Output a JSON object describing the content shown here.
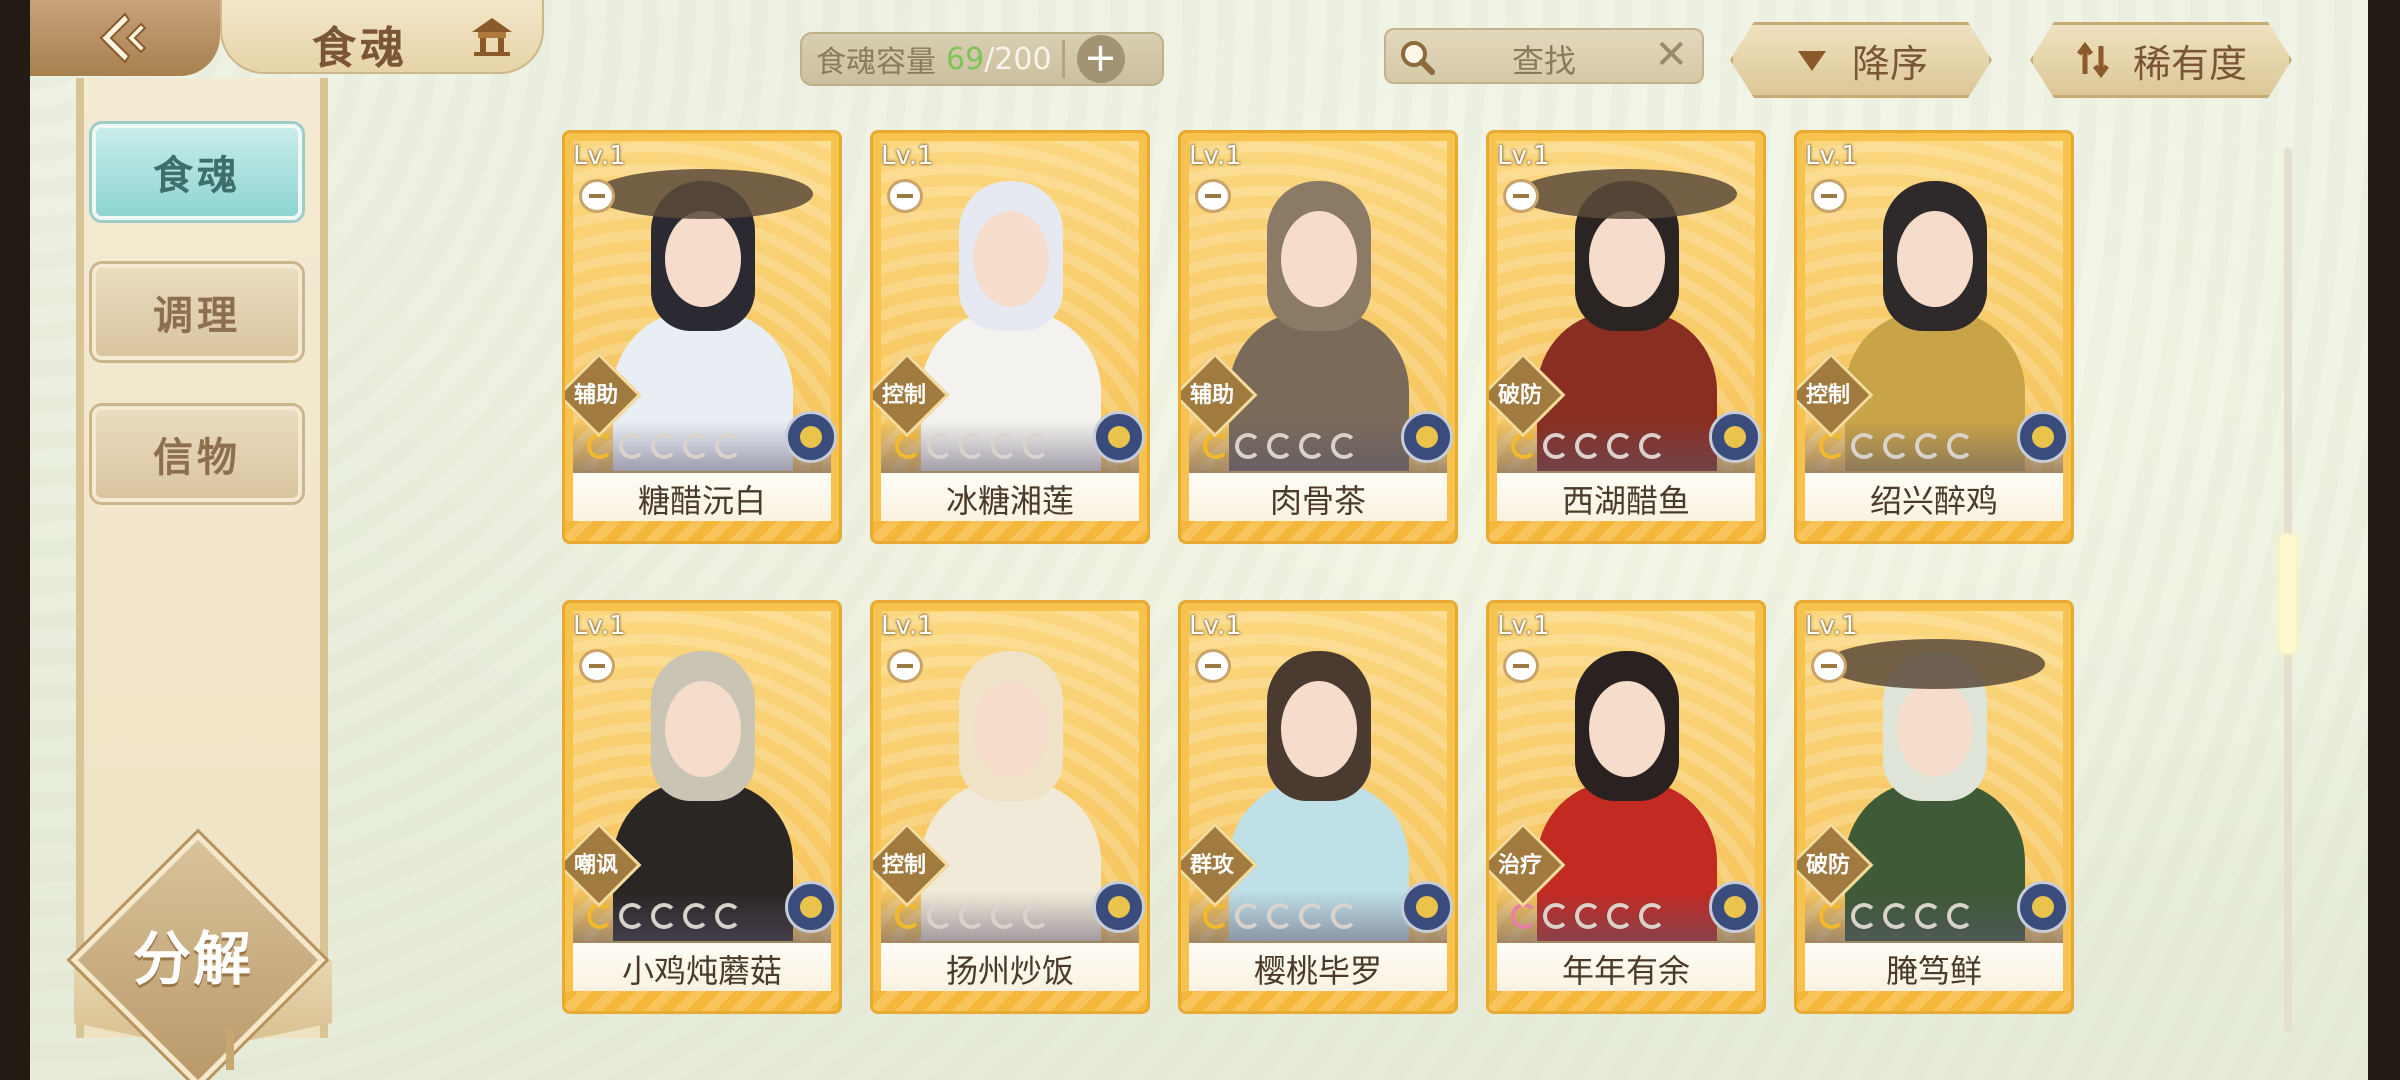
{
  "header": {
    "title": "食魂",
    "back_icon": "back-arrow-icon",
    "home_icon": "pavilion-icon"
  },
  "capacity": {
    "label": "食魂容量",
    "current": "69",
    "max": "/200",
    "add_icon": "plus-icon"
  },
  "search": {
    "label": "查找",
    "clear": "✕"
  },
  "sort": {
    "order_label": "降序",
    "rarity_label": "稀有度"
  },
  "sidebar": {
    "items": [
      {
        "label": "食魂",
        "active": true
      },
      {
        "label": "调理",
        "active": false
      },
      {
        "label": "信物",
        "active": false
      }
    ],
    "decompose_label": "分解"
  },
  "cards": [
    {
      "level": "Lv.1",
      "role": "辅助",
      "name": "糖醋沅白",
      "rank": 1,
      "hair": "#2b2a33",
      "outfit": "#e9eef5",
      "hat": true
    },
    {
      "level": "Lv.1",
      "role": "控制",
      "name": "冰糖湘莲",
      "rank": 1,
      "hair": "#e6e9f2",
      "outfit": "#f4f2ee",
      "hat": false
    },
    {
      "level": "Lv.1",
      "role": "辅助",
      "name": "肉骨茶",
      "rank": 1,
      "hair": "#8a7a66",
      "outfit": "#7a6a5a",
      "hat": false
    },
    {
      "level": "Lv.1",
      "role": "破防",
      "name": "西湖醋鱼",
      "rank": 1,
      "hair": "#2a2522",
      "outfit": "#8a2e22",
      "hat": true
    },
    {
      "level": "Lv.1",
      "role": "控制",
      "name": "绍兴醉鸡",
      "rank": 1,
      "hair": "#2e2a2c",
      "outfit": "#c9a347",
      "hat": false
    },
    {
      "level": "Lv.1",
      "role": "嘲讽",
      "name": "小鸡炖蘑菇",
      "rank": 1,
      "hair": "#c9c4b4",
      "outfit": "#2a2624",
      "hat": false
    },
    {
      "level": "Lv.1",
      "role": "控制",
      "name": "扬州炒饭",
      "rank": 1,
      "hair": "#efe2c6",
      "outfit": "#f2ead8",
      "hat": false
    },
    {
      "level": "Lv.1",
      "role": "群攻",
      "name": "樱桃毕罗",
      "rank": 1,
      "hair": "#4a3a30",
      "outfit": "#bfe0e6",
      "hat": false
    },
    {
      "level": "Lv.1",
      "role": "治疗",
      "name": "年年有余",
      "rank": 1,
      "hair": "#2a2220",
      "outfit": "#c22a22",
      "hat": false,
      "pink": true
    },
    {
      "level": "Lv.1",
      "role": "破防",
      "name": "腌笃鲜",
      "rank": 1,
      "hair": "#dfe4d8",
      "outfit": "#3f5a36",
      "hat": true
    }
  ],
  "colors": {
    "card_gold": "#f7c24d",
    "active_tab": "#8ed5d2",
    "capacity_count": "#7fc45a"
  }
}
